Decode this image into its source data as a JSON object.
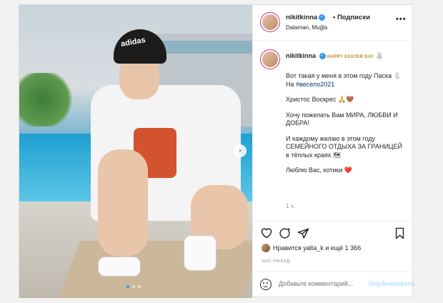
{
  "header": {
    "username": "nikitkinna",
    "follow_label": "• Подписки",
    "location": "Dalaman, Muğla",
    "more_label": "•••"
  },
  "photo": {
    "hat_text": "adidas",
    "next_arrow": "›",
    "slide_count": 3,
    "active_slide": 1
  },
  "caption": {
    "username": "nikitkinna",
    "headline": "HAPPY EASTER DAY",
    "line1": "Вот такая у меня в этом году Паска 🐇",
    "line2_prefix": "На ",
    "hashtag": "#весело2021",
    "line3": "Христос Воскрес 🙏🤎",
    "line4": "Хочу пожелать Вам МИРА, ЛЮБВИ И ДОБРА!",
    "line5": "И каждому желаю в этом году СЕМЕЙНОГО ОТДЫХА ЗА ГРАНИЦЕЙ в тёплых краях 🗺",
    "line6": "Люблю Вас, котики ❤️",
    "time": "1 ч."
  },
  "likes": {
    "text": "Нравится yalta_k и ещё 1 366"
  },
  "time_ago": "ЧАС НАЗАД",
  "comment": {
    "placeholder": "Добавьте комментарий...",
    "publish_label": "Опубликовать"
  },
  "colors": {
    "accent_blue": "#3897f0",
    "publish_disabled": "#b2dffc",
    "heart_red": "#ed4956"
  },
  "icons": [
    "heart-icon",
    "comment-icon",
    "share-icon",
    "bookmark-icon",
    "emoji-icon",
    "verified-icon",
    "more-icon"
  ]
}
